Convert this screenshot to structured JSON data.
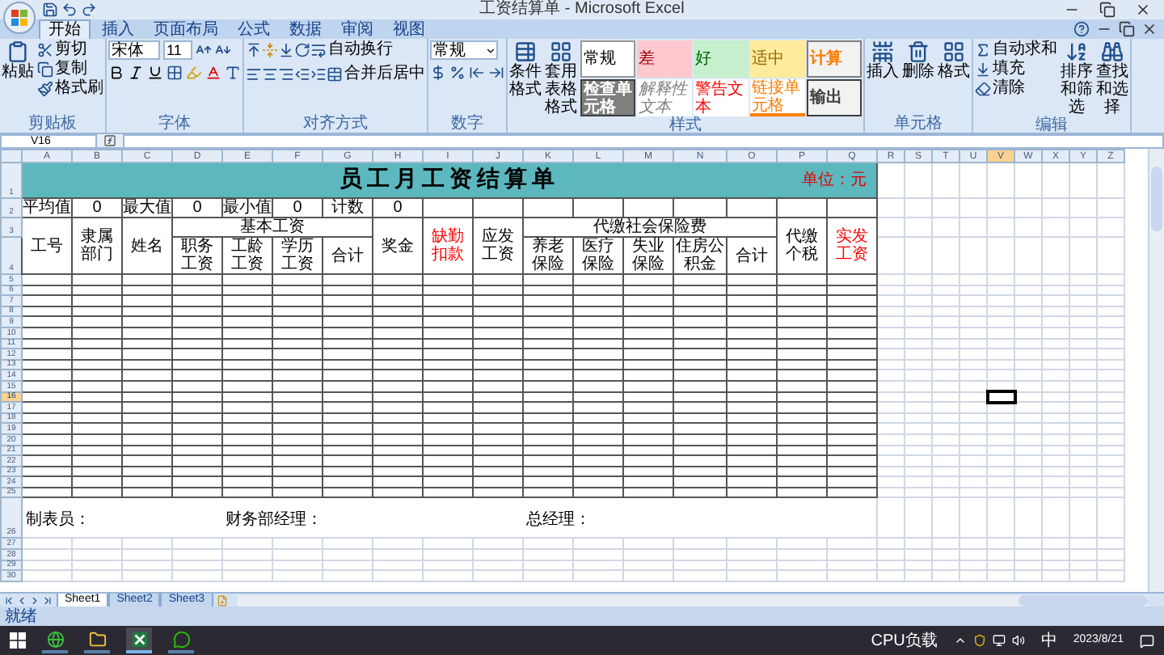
{
  "window": {
    "title": "工资结算单 - Microsoft Excel"
  },
  "ribbon_tabs": [
    {
      "label": "开始",
      "selected": true
    },
    {
      "label": "插入",
      "selected": false
    },
    {
      "label": "页面布局",
      "selected": false
    },
    {
      "label": "公式",
      "selected": false
    },
    {
      "label": "数据",
      "selected": false
    },
    {
      "label": "审阅",
      "selected": false
    },
    {
      "label": "视图",
      "selected": false
    }
  ],
  "clipboard": {
    "label": "剪贴板",
    "paste": "粘贴",
    "cut": "剪切",
    "copy": "复制",
    "format_painter": "格式刷"
  },
  "font": {
    "label": "字体",
    "font_name": "宋体",
    "font_size": "11"
  },
  "alignment": {
    "label": "对齐方式",
    "wrap_text": "自动换行",
    "merge_center": "合并后居中"
  },
  "number": {
    "label": "数字",
    "format": "常规"
  },
  "styles": {
    "label": "样式",
    "conditional": "条件格式",
    "table_format": "套用表格格式",
    "cell_styles": [
      {
        "label": "常规",
        "kind": "normal"
      },
      {
        "label": "差",
        "kind": "bad"
      },
      {
        "label": "好",
        "kind": "good"
      },
      {
        "label": "适中",
        "kind": "neutral"
      },
      {
        "label": "计算",
        "kind": "calc"
      },
      {
        "label": "检查单元格",
        "kind": "check"
      },
      {
        "label": "解释性文本",
        "kind": "explanatory"
      },
      {
        "label": "警告文本",
        "kind": "warning"
      },
      {
        "label": "链接单元格",
        "kind": "linked"
      },
      {
        "label": "输出",
        "kind": "output"
      }
    ]
  },
  "cells": {
    "label": "单元格",
    "insert": "插入",
    "delete": "删除",
    "format": "格式"
  },
  "editing": {
    "label": "编辑",
    "autosum": "自动求和",
    "fill": "填充",
    "clear": "清除",
    "sort": "排序和筛选",
    "find": "查找和选择"
  },
  "name_box": "V16",
  "columns": [
    {
      "label": "A",
      "selected": false
    },
    {
      "label": "B",
      "selected": false
    },
    {
      "label": "C",
      "selected": false
    },
    {
      "label": "D",
      "selected": false
    },
    {
      "label": "E",
      "selected": false
    },
    {
      "label": "F",
      "selected": false
    },
    {
      "label": "G",
      "selected": false
    },
    {
      "label": "H",
      "selected": false
    },
    {
      "label": "I",
      "selected": false
    },
    {
      "label": "J",
      "selected": false
    },
    {
      "label": "K",
      "selected": false
    },
    {
      "label": "L",
      "selected": false
    },
    {
      "label": "M",
      "selected": false
    },
    {
      "label": "N",
      "selected": false
    },
    {
      "label": "O",
      "selected": false
    },
    {
      "label": "P",
      "selected": false
    },
    {
      "label": "Q",
      "selected": false
    },
    {
      "label": "R",
      "selected": false
    },
    {
      "label": "S",
      "selected": false
    },
    {
      "label": "T",
      "selected": false
    },
    {
      "label": "U",
      "selected": false
    },
    {
      "label": "V",
      "selected": true
    },
    {
      "label": "W",
      "selected": false
    },
    {
      "label": "X",
      "selected": false
    },
    {
      "label": "Y",
      "selected": false
    },
    {
      "label": "Z",
      "selected": false
    }
  ],
  "row_headers": [
    {
      "label": "1",
      "selected": false
    },
    {
      "label": "2",
      "selected": false
    },
    {
      "label": "3",
      "selected": false
    },
    {
      "label": "4",
      "selected": false
    },
    {
      "label": "5",
      "selected": false
    },
    {
      "label": "6",
      "selected": false
    },
    {
      "label": "7",
      "selected": false
    },
    {
      "label": "8",
      "selected": false
    },
    {
      "label": "9",
      "selected": false
    },
    {
      "label": "10",
      "selected": false
    },
    {
      "label": "11",
      "selected": false
    },
    {
      "label": "12",
      "selected": false
    },
    {
      "label": "13",
      "selected": false
    },
    {
      "label": "14",
      "selected": false
    },
    {
      "label": "15",
      "selected": false
    },
    {
      "label": "16",
      "selected": true
    },
    {
      "label": "17",
      "selected": false
    },
    {
      "label": "18",
      "selected": false
    },
    {
      "label": "19",
      "selected": false
    },
    {
      "label": "20",
      "selected": false
    },
    {
      "label": "21",
      "selected": false
    },
    {
      "label": "22",
      "selected": false
    },
    {
      "label": "23",
      "selected": false
    },
    {
      "label": "24",
      "selected": false
    },
    {
      "label": "25",
      "selected": false
    },
    {
      "label": "26",
      "selected": false
    },
    {
      "label": "27",
      "selected": false
    },
    {
      "label": "28",
      "selected": false
    },
    {
      "label": "29",
      "selected": false
    },
    {
      "label": "30",
      "selected": false
    }
  ],
  "sheet": {
    "title": "员工月工资结算单",
    "unit": "单位：元",
    "summary": [
      {
        "label": "平均值",
        "value": "0"
      },
      {
        "label": "最大值",
        "value": "0"
      },
      {
        "label": "最小值",
        "value": "0"
      },
      {
        "label": "计数",
        "value": "0"
      }
    ],
    "headers": [
      {
        "label": "工号",
        "color": "#000000"
      },
      {
        "label": "隶属部门",
        "color": "#000000"
      },
      {
        "label": "姓名",
        "color": "#000000"
      },
      {
        "label": "基本工资",
        "color": "#000000",
        "children": [
          "职务工资",
          "工龄工资",
          "学历工资",
          "合计"
        ]
      },
      {
        "label": "奖金",
        "color": "#000000"
      },
      {
        "label": "缺勤扣款",
        "color": "#ff0000"
      },
      {
        "label": "应发工资",
        "color": "#000000"
      },
      {
        "label": "代缴社会保险费",
        "color": "#000000",
        "children": [
          "养老保险",
          "医疗保险",
          "失业保险",
          "住房公积金",
          "合计"
        ]
      },
      {
        "label": "代缴个税",
        "color": "#000000"
      },
      {
        "label": "实发工资",
        "color": "#ff0000"
      }
    ],
    "signatures": [
      "制表员：",
      "财务部经理：",
      "总经理："
    ]
  },
  "sheet_tabs": [
    {
      "label": "Sheet1",
      "selected": true
    },
    {
      "label": "Sheet2",
      "selected": false
    },
    {
      "label": "Sheet3",
      "selected": false
    }
  ],
  "status_bar": {
    "text": "就绪"
  },
  "taskbar": {
    "apps": [
      {
        "kind": "browser",
        "active": false
      },
      {
        "kind": "folder",
        "active": false
      },
      {
        "kind": "excel",
        "active": true
      },
      {
        "kind": "chat",
        "active": false
      }
    ],
    "tray_text": "CPU负载",
    "ime": "中",
    "date": "2023/8/21"
  }
}
